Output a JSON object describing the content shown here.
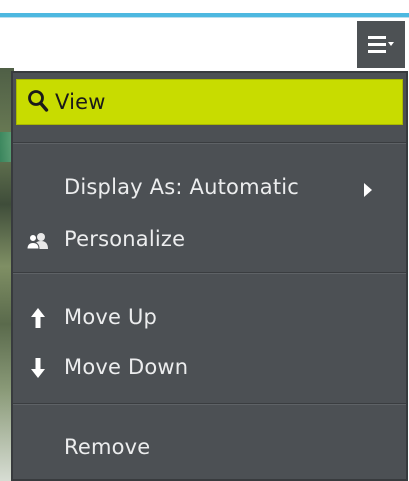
{
  "header": {
    "accent_color": "#4db8e0",
    "menu_button_icon": "hamburger-dropdown-icon"
  },
  "menu": {
    "highlight_color": "#c8dc00",
    "background_color": "#4c5054",
    "items": [
      {
        "label": "View",
        "icon": "search-icon",
        "selected": true
      },
      {
        "label": "Display As: Automatic",
        "icon": "chevron-right-icon",
        "has_submenu": true
      },
      {
        "label": "Personalize",
        "icon": "users-icon"
      },
      {
        "label": "Move Up",
        "icon": "arrow-up-icon"
      },
      {
        "label": "Move Down",
        "icon": "arrow-down-icon"
      },
      {
        "label": "Remove",
        "icon": ""
      }
    ]
  }
}
